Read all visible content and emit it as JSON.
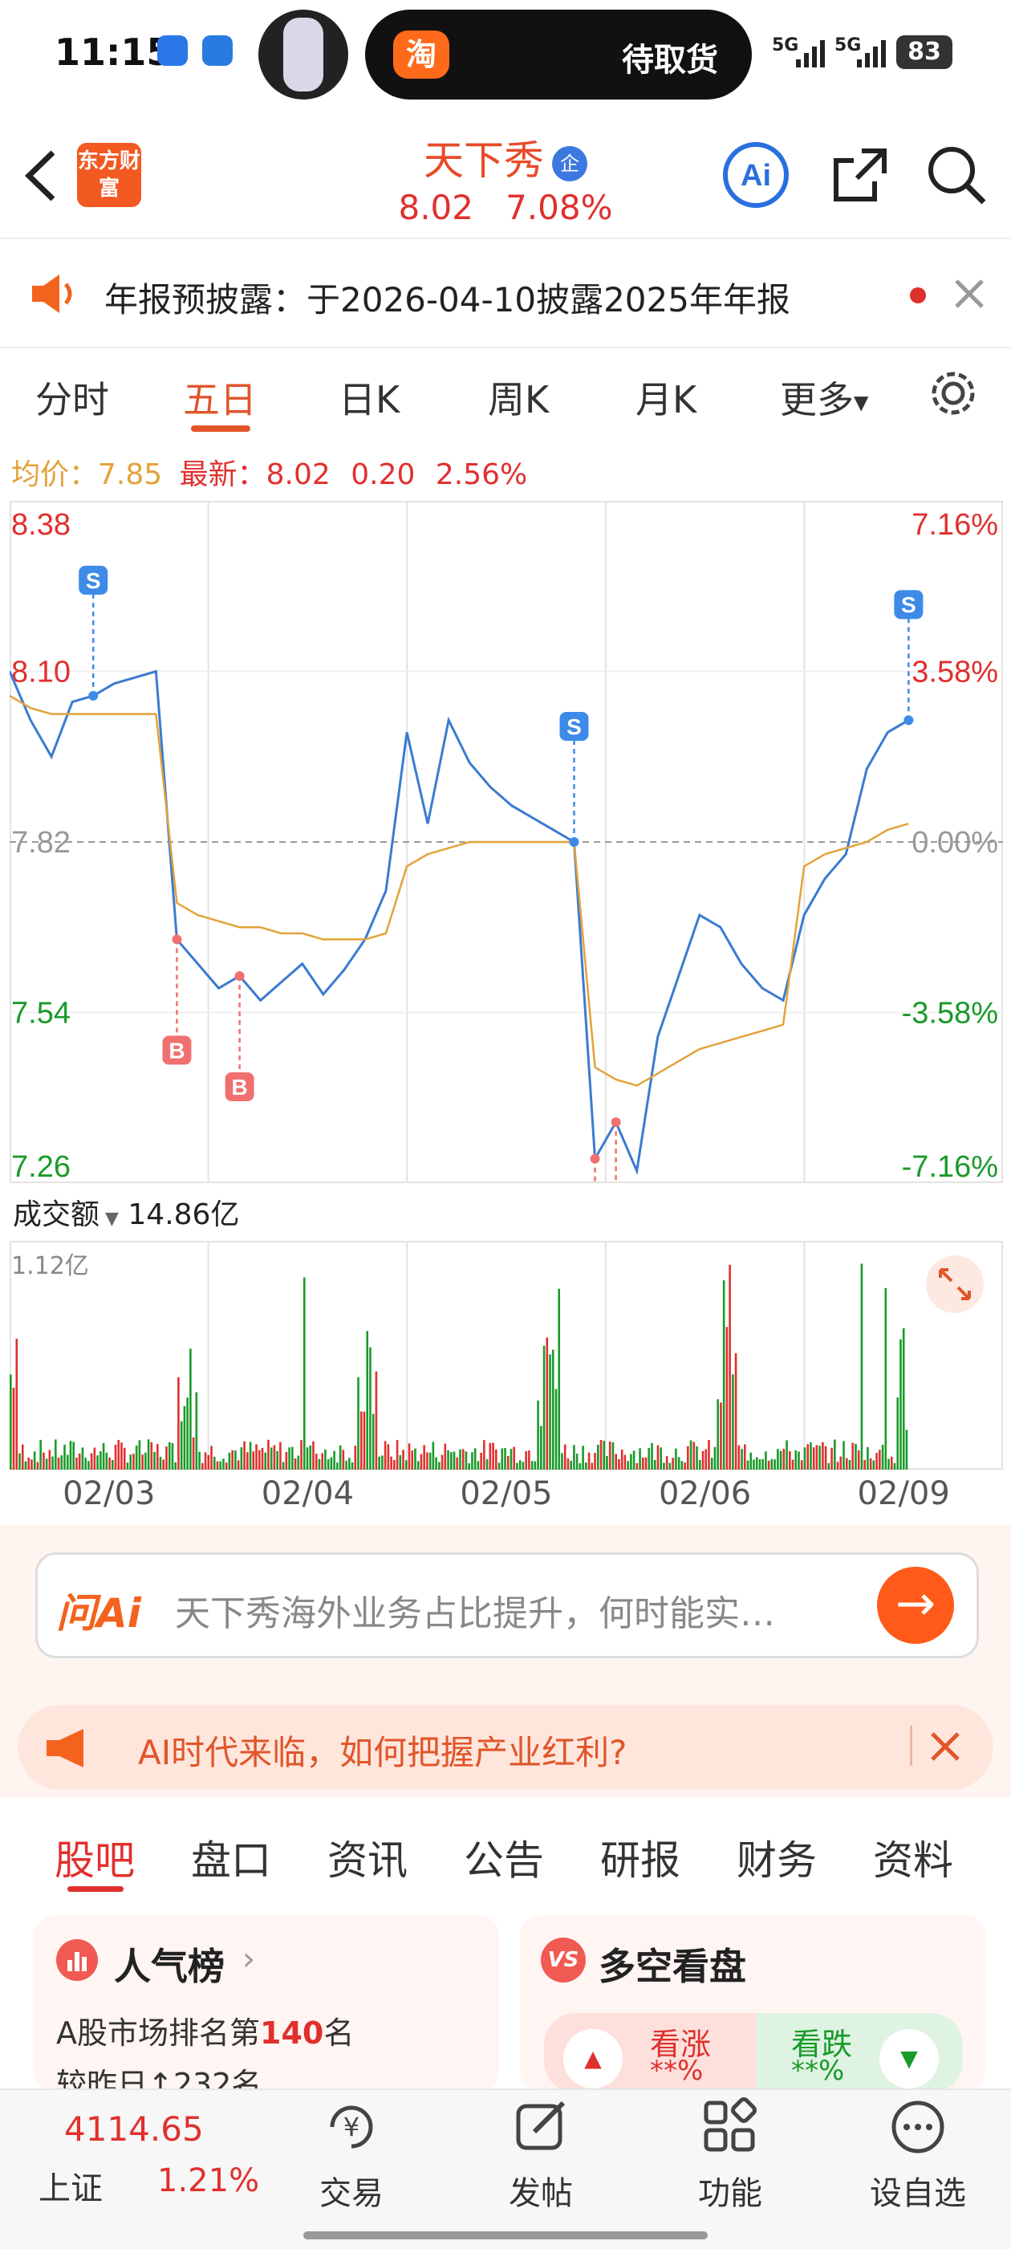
{
  "status_bar": {
    "time": "11:15",
    "pill_app": "淘",
    "pill_text": "待取货",
    "signal1": "5G",
    "signal2": "5G",
    "battery": "83"
  },
  "header": {
    "logo": "东方财富",
    "title": "天下秀",
    "title_badge": "企",
    "price": "8.02",
    "change_pct": "7.08%"
  },
  "notice": {
    "text": "年报预披露：于2026-04-10披露2025年年报"
  },
  "chart_tabs": [
    "分时",
    "五日",
    "日K",
    "周K",
    "月K",
    "更多"
  ],
  "avg_line": {
    "avg_label": "均价：",
    "avg": "7.85",
    "latest_label": "最新：",
    "latest": "8.02",
    "chg": "0.20",
    "pct": "2.56%"
  },
  "chart_data": {
    "type": "line",
    "title": "",
    "x": [
      "02/03",
      "02/04",
      "02/05",
      "02/06",
      "02/09"
    ],
    "y_ticks_left": [
      "8.38",
      "8.10",
      "7.82",
      "7.54",
      "7.26"
    ],
    "y_ticks_right": [
      "7.16%",
      "3.58%",
      "0.00%",
      "-3.58%",
      "-7.16%"
    ],
    "ylim": [
      7.26,
      8.38
    ],
    "prev_close": 7.82,
    "series": [
      {
        "values": [
          8.1,
          8.02,
          7.96,
          8.05,
          8.06,
          8.08,
          8.09,
          8.1,
          7.66,
          7.62,
          7.58,
          7.6,
          7.56,
          7.59,
          7.62,
          7.57,
          7.61,
          7.66,
          7.74,
          8.0,
          7.85,
          8.02,
          7.95,
          7.91,
          7.88,
          7.86,
          7.84,
          7.82,
          7.3,
          7.36,
          7.28,
          7.5,
          7.6,
          7.7,
          7.68,
          7.62,
          7.58,
          7.56,
          7.7,
          7.76,
          7.8,
          7.94,
          8.0,
          8.02
        ]
      },
      {
        "values": [
          8.06,
          8.04,
          8.03,
          8.03,
          8.03,
          8.03,
          8.03,
          8.03,
          7.72,
          7.7,
          7.69,
          7.68,
          7.68,
          7.67,
          7.67,
          7.66,
          7.66,
          7.66,
          7.67,
          7.78,
          7.8,
          7.81,
          7.82,
          7.82,
          7.82,
          7.82,
          7.82,
          7.82,
          7.45,
          7.43,
          7.42,
          7.44,
          7.46,
          7.48,
          7.49,
          7.5,
          7.51,
          7.52,
          7.78,
          7.8,
          7.81,
          7.82,
          7.84,
          7.85
        ]
      }
    ],
    "signals": [
      "S",
      "B",
      "B",
      "S",
      "B",
      "B",
      "S"
    ],
    "volume_label": "成交额",
    "volume_total": "14.86亿",
    "volume_max": "1.12亿",
    "grid": true,
    "colors": {
      "price": "#3b7bd1",
      "avg": "#e3a33a",
      "up": "#e0302e",
      "down": "#1a9a2a"
    }
  },
  "ask": {
    "brand": "问Ai",
    "placeholder": "天下秀海外业务占比提升，何时能实…"
  },
  "banner": {
    "text": "AI时代来临，如何把握产业红利?"
  },
  "sub_tabs": [
    "股吧",
    "盘口",
    "资讯",
    "公告",
    "研报",
    "财务",
    "资料"
  ],
  "card_left": {
    "title": "人气榜",
    "line1_prefix": "A股市场排名第",
    "line1_num": "140",
    "line1_suffix": "名",
    "line2": "较昨日↑232名"
  },
  "card_right": {
    "badge": "VS",
    "title": "多空看盘",
    "bull": "看涨",
    "bear": "看跌",
    "bull_pct": "**%",
    "bear_pct": "**%"
  },
  "bottom_nav": {
    "index_value": "4114.65",
    "index_name": "上证",
    "index_pct": "1.21%",
    "items": [
      "交易",
      "发帖",
      "功能",
      "设自选"
    ]
  }
}
